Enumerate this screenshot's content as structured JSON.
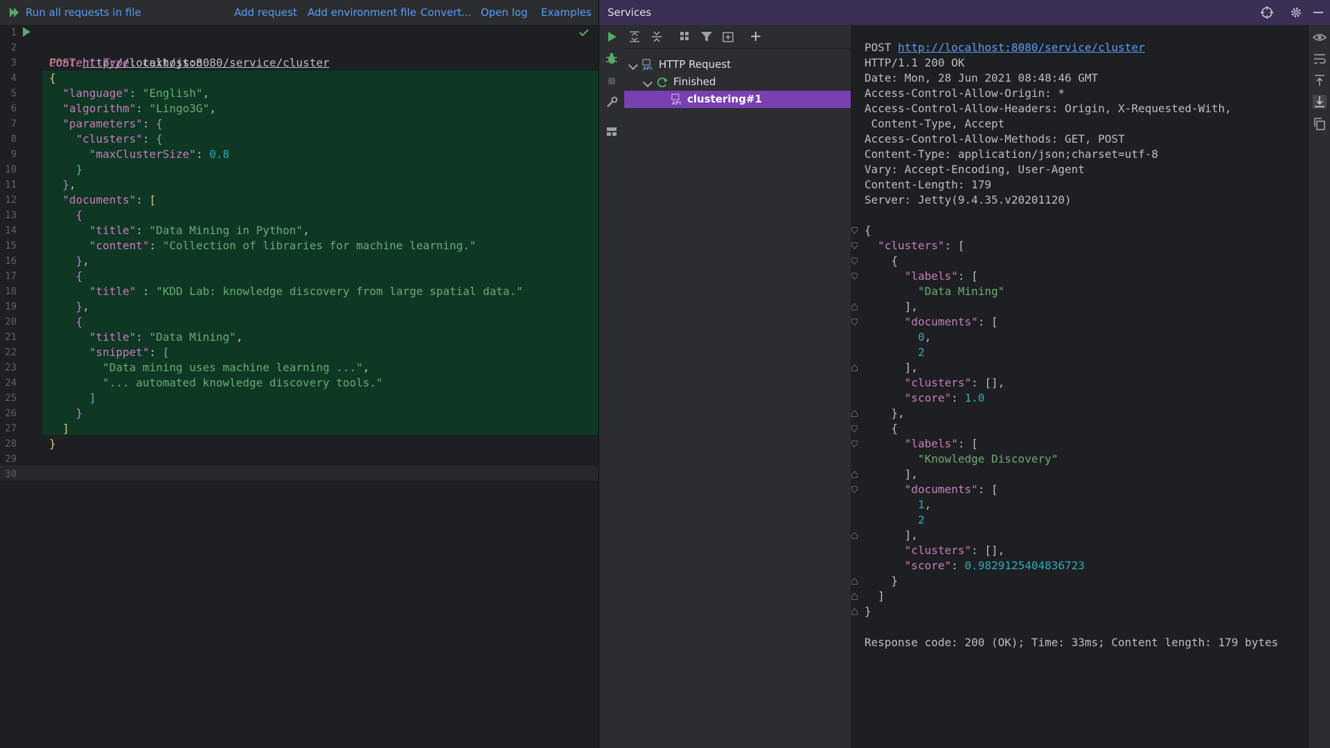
{
  "toolbar": {
    "run_all": "Run all requests in file",
    "add_request": "Add request",
    "add_env": "Add environment file",
    "convert": "Convert...",
    "open_log": "Open log",
    "examples": "Examples"
  },
  "editor": {
    "line_numbers": [
      "1",
      "2",
      "3",
      "4",
      "5",
      "6",
      "7",
      "8",
      "9",
      "10",
      "11",
      "12",
      "13",
      "14",
      "15",
      "16",
      "17",
      "18",
      "19",
      "20",
      "21",
      "22",
      "23",
      "24",
      "25",
      "26",
      "27",
      "28",
      "29",
      "30"
    ],
    "method": "POST",
    "url": "http://localhost:8080/service/cluster",
    "header_name": "Content-Type",
    "header_value": ": text/json",
    "body": {
      "language_key": "\"language\"",
      "language_val": "\"English\"",
      "algorithm_key": "\"algorithm\"",
      "algorithm_val": "\"Lingo3G\"",
      "parameters_key": "\"parameters\"",
      "clusters_key": "\"clusters\"",
      "max_key": "\"maxClusterSize\"",
      "max_val": "0.8",
      "documents_key": "\"documents\"",
      "title_key": "\"title\"",
      "content_key": "\"content\"",
      "snippet_key": "\"snippet\"",
      "doc1_title": "\"Data Mining in Python\"",
      "doc1_content": "\"Collection of libraries for machine learning.\"",
      "doc2_title": "\"KDD Lab: knowledge discovery from large spatial data.\"",
      "doc3_title": "\"Data Mining\"",
      "snippet1": "\"Data mining uses machine learning ...\"",
      "snippet2": "\"... automated knowledge discovery tools.\""
    }
  },
  "services": {
    "title": "Services",
    "tree": {
      "root": "HTTP Request",
      "status": "Finished",
      "item": "clustering#1"
    }
  },
  "response": {
    "request_method": "POST",
    "request_url": "http://localhost:8080/service/cluster",
    "headers": [
      "HTTP/1.1 200 OK",
      "Date: Mon, 28 Jun 2021 08:48:46 GMT",
      "Access-Control-Allow-Origin: *",
      "Access-Control-Allow-Headers: Origin, X-Requested-With,",
      " Content-Type, Accept",
      "Access-Control-Allow-Methods: GET, POST",
      "Content-Type: application/json;charset=utf-8",
      "Vary: Accept-Encoding, User-Agent",
      "Content-Length: 179",
      "Server: Jetty(9.4.35.v20201120)"
    ],
    "body": {
      "clusters_key": "\"clusters\"",
      "labels_key": "\"labels\"",
      "documents_key": "\"documents\"",
      "score_key": "\"score\"",
      "label1": "\"Data Mining\"",
      "label2": "\"Knowledge Discovery\"",
      "docs1": [
        "0",
        "2"
      ],
      "docs2": [
        "1",
        "2"
      ],
      "score1": "1.0",
      "score2": "0.9829125404836723"
    },
    "summary": "Response code: 200 (OK); Time: 33ms; Content length: 179 bytes"
  },
  "colors": {
    "accent_purple": "#7a3fb0",
    "header_purple": "#3c2f55",
    "link_blue": "#589df6",
    "run_green": "#59a869",
    "string_green": "#6aab73",
    "number_cyan": "#2aacb8",
    "key_pink": "#c77dbb"
  }
}
